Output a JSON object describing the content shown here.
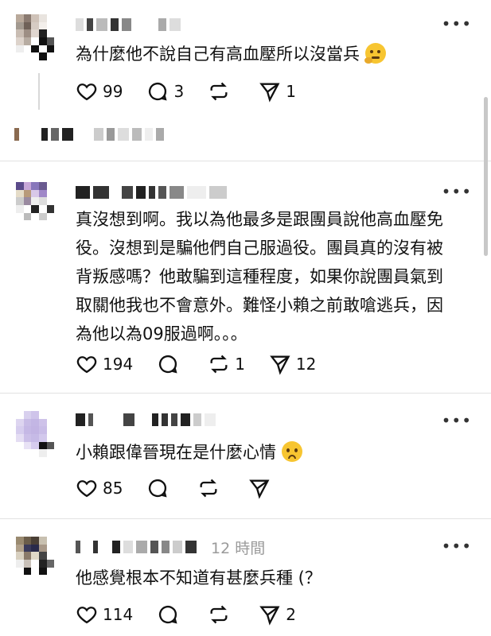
{
  "posts": [
    {
      "text": "為什麼他不說自己有高血壓所以沒當兵",
      "emoji": "thinking-face",
      "likes": "99",
      "comments": "3",
      "reposts": "",
      "shares": "1",
      "time": ""
    },
    {
      "text": "真沒想到啊。我以為他最多是跟團員說他高血壓免\n役。沒想到是騙他們自己服過役。團員真的沒有被\n背叛感嗎？他敢騙到這種程度，如果你說團員氣到\n取關他我也不會意外。難怪小賴之前敢嗆逃兵，因\n為他以為09服過啊。。。",
      "likes": "194",
      "comments": "",
      "reposts": "1",
      "shares": "12",
      "time": ""
    },
    {
      "text": "小賴跟偉晉現在是什麼心情",
      "emoji": "worried-face",
      "likes": "85",
      "comments": "",
      "reposts": "",
      "shares": "",
      "time": ""
    },
    {
      "text": "他感覺根本不知道有甚麼兵種 (？",
      "likes": "114",
      "comments": "",
      "reposts": "",
      "shares": "2",
      "time": "12 時間"
    }
  ],
  "more_label": "•••",
  "colors": {
    "divider": "#e2e2e2",
    "text": "#111111",
    "muted": "#9a9a9a"
  }
}
